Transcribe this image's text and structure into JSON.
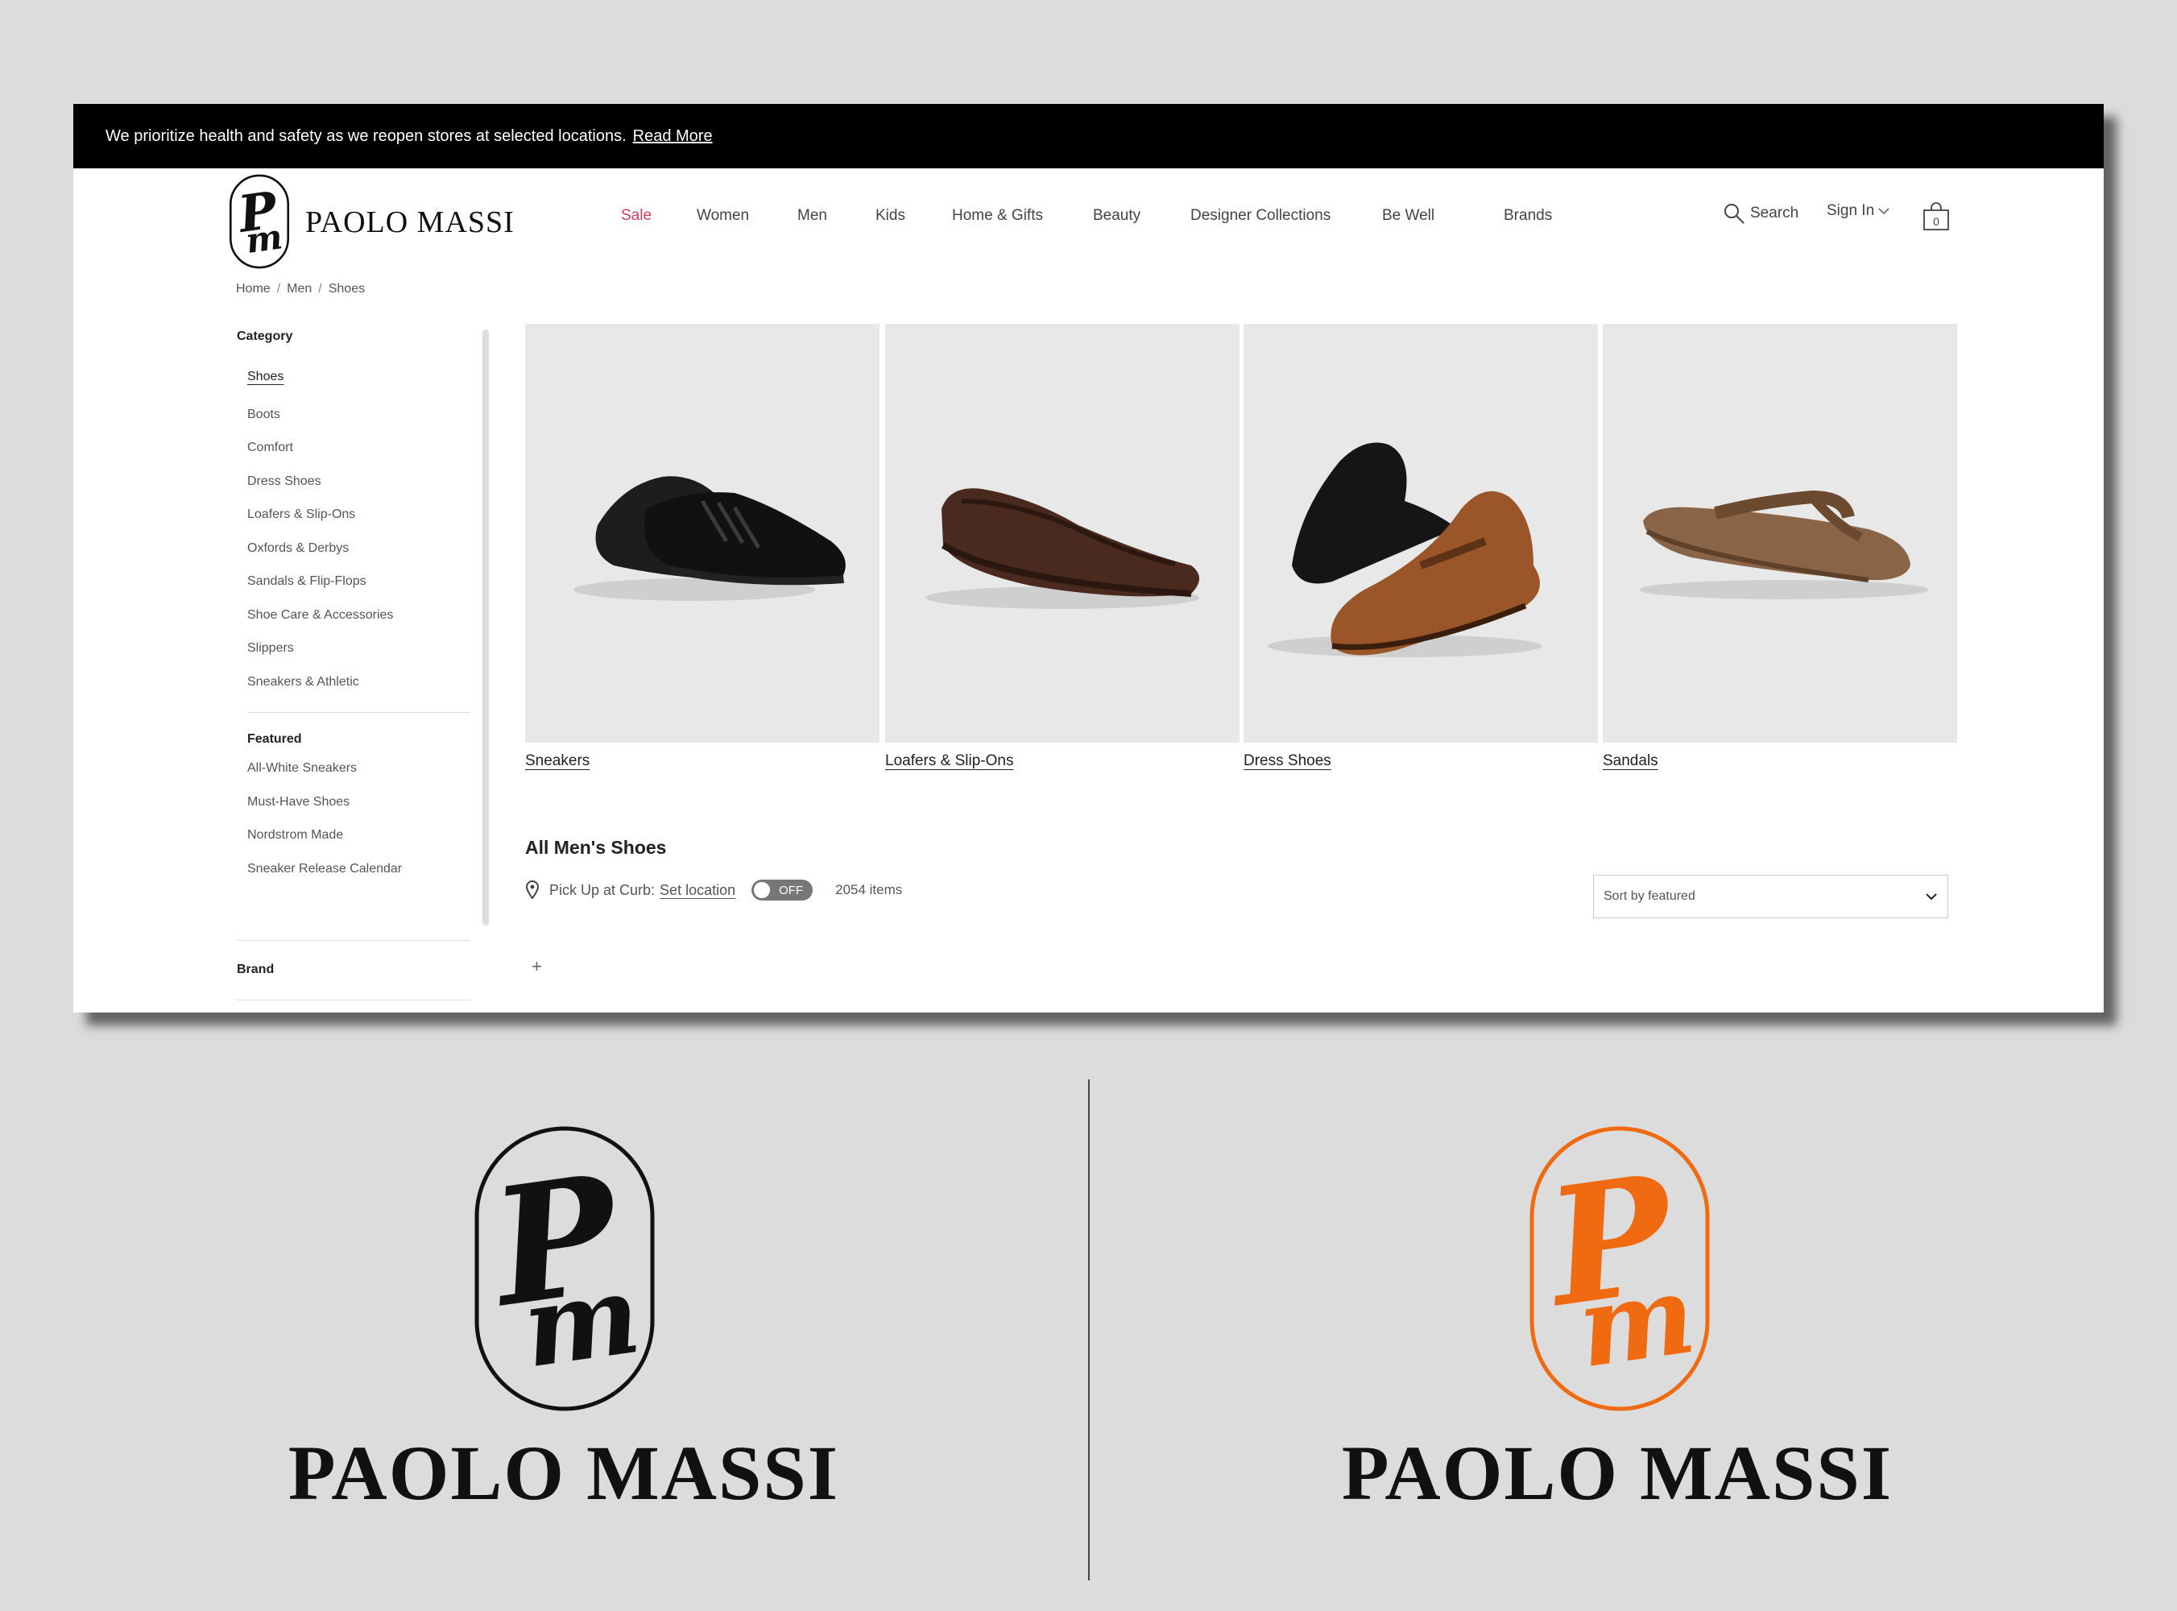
{
  "banner": {
    "message": "We prioritize health and safety as we reopen stores at selected locations.",
    "link": "Read More"
  },
  "brand": {
    "name": "PAOLO MASSI",
    "monogram": "Pm",
    "colors": {
      "black": "#111111",
      "orange": "#ef6a10",
      "sale": "#c8405a"
    }
  },
  "nav": {
    "items": [
      "Sale",
      "Women",
      "Men",
      "Kids",
      "Home & Gifts",
      "Beauty",
      "Designer Collections",
      "Be Well",
      "Brands"
    ]
  },
  "utility": {
    "search": "Search",
    "sign_in": "Sign In",
    "bag_count": "0"
  },
  "breadcrumb": [
    "Home",
    "Men",
    "Shoes"
  ],
  "sidebar": {
    "category_title": "Category",
    "categories": [
      "Shoes",
      "Boots",
      "Comfort",
      "Dress Shoes",
      "Loafers & Slip-Ons",
      "Oxfords & Derbys",
      "Sandals & Flip-Flops",
      "Shoe Care & Accessories",
      "Slippers",
      "Sneakers & Athletic"
    ],
    "featured_title": "Featured",
    "featured": [
      "All-White Sneakers",
      "Must-Have Shoes",
      "Nordstrom Made",
      "Sneaker Release Calendar"
    ],
    "brand_title": "Brand"
  },
  "tiles": [
    {
      "label": "Sneakers",
      "icon": "sneaker-image"
    },
    {
      "label": "Loafers & Slip-Ons",
      "icon": "loafer-image"
    },
    {
      "label": "Dress Shoes",
      "icon": "dress-shoe-image"
    },
    {
      "label": "Sandals",
      "icon": "sandal-image"
    }
  ],
  "listing": {
    "title": "All Men's Shoes",
    "pickup_label": "Pick Up at Curb:",
    "set_location": "Set location",
    "toggle_state": "OFF",
    "item_count": "2054 items",
    "sort_value": "Sort by featured"
  },
  "logos": {
    "left_name": "PAOLO MASSI",
    "right_name": "PAOLO MASSI"
  }
}
